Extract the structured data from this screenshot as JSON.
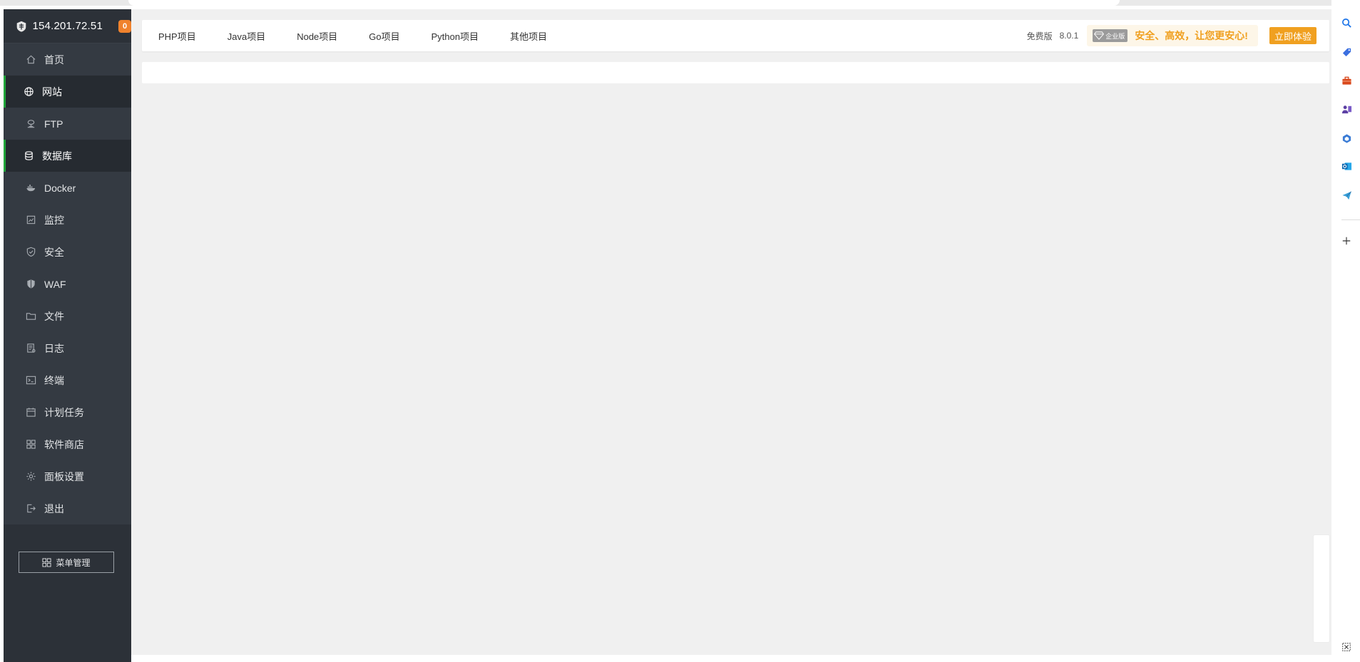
{
  "sidebar": {
    "ip": "154.201.72.51",
    "badge_count": "0",
    "items": [
      {
        "label": "首页",
        "icon": "home-icon",
        "active": false
      },
      {
        "label": "网站",
        "icon": "globe-icon",
        "active": true
      },
      {
        "label": "FTP",
        "icon": "ftp-icon",
        "active": false
      },
      {
        "label": "数据库",
        "icon": "database-icon",
        "active": true
      },
      {
        "label": "Docker",
        "icon": "docker-icon",
        "active": false
      },
      {
        "label": "监控",
        "icon": "monitor-icon",
        "active": false
      },
      {
        "label": "安全",
        "icon": "shield-check-icon",
        "active": false
      },
      {
        "label": "WAF",
        "icon": "waf-shield-icon",
        "active": false
      },
      {
        "label": "文件",
        "icon": "folder-icon",
        "active": false
      },
      {
        "label": "日志",
        "icon": "log-icon",
        "active": false
      },
      {
        "label": "终端",
        "icon": "terminal-icon",
        "active": false
      },
      {
        "label": "计划任务",
        "icon": "calendar-icon",
        "active": false
      },
      {
        "label": "软件商店",
        "icon": "apps-grid-icon",
        "active": false
      },
      {
        "label": "面板设置",
        "icon": "gear-icon",
        "active": false
      },
      {
        "label": "退出",
        "icon": "logout-icon",
        "active": false
      }
    ],
    "menu_manage_label": "菜单管理"
  },
  "topbar": {
    "tabs": [
      "PHP项目",
      "Java项目",
      "Node项目",
      "Go项目",
      "Python项目",
      "其他项目"
    ],
    "edition_label": "免费版",
    "version": "8.0.1",
    "enterprise_tag": "企业版",
    "promo_text": "安全、高效，让您更安心!",
    "try_button": "立即体验"
  },
  "colors": {
    "sidebar_bg": "#2c3138",
    "active_accent": "#20a53a",
    "badge": "#f0822d",
    "promo": "#f0a020",
    "main_bg": "#f0f0f0"
  },
  "right_rail": {
    "icons": [
      "search-icon",
      "tag-icon",
      "toolbox-icon",
      "people-icon",
      "copilot-icon",
      "outlook-icon",
      "send-icon",
      "add-icon",
      "screenshot-icon"
    ]
  }
}
